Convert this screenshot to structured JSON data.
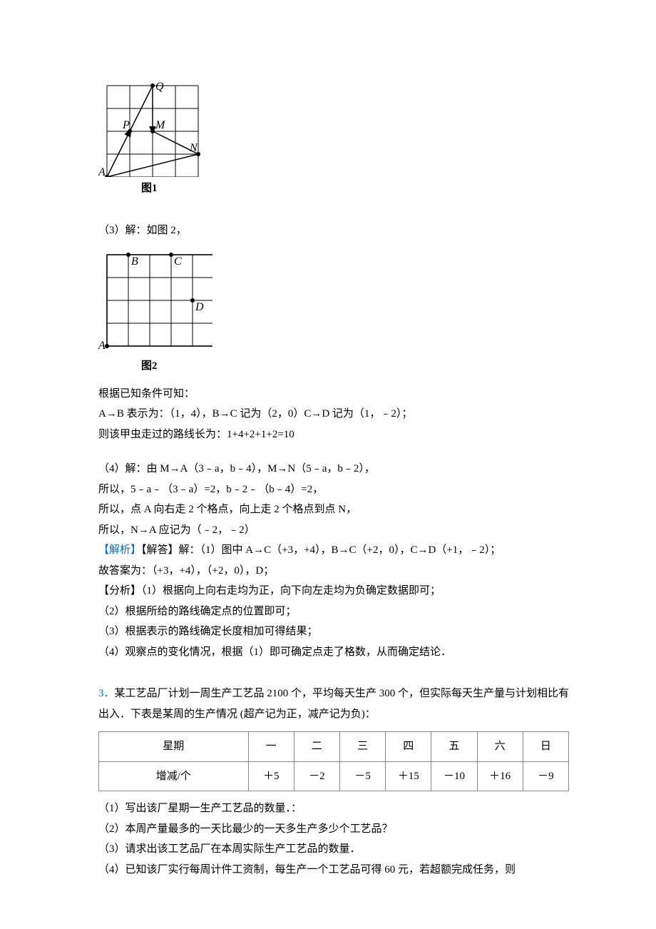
{
  "figure1": {
    "caption": "图1",
    "labels": {
      "A": "A",
      "P": "P",
      "Q": "Q",
      "M": "M",
      "N": "N"
    }
  },
  "section3_intro": "（3）解：如图 2，",
  "figure2": {
    "caption": "图2",
    "labels": {
      "A": "A",
      "B": "B",
      "C": "C",
      "D": "D"
    }
  },
  "p_known": "根据已知条件可知：",
  "p_ab": "A→B 表示为：（1，4），B→C 记为（2，0）C→D 记为（1，﹣2）；",
  "p_length": "则该甲虫走过的路线长为：1+4+2+1+2=10",
  "section4": {
    "l1": "（4）解：由 M→A（3﹣a，b﹣4），M→N（5﹣a，b﹣2），",
    "l2": "所以，5﹣a﹣（3﹣a）=2，b﹣2﹣（b﹣4）=2，",
    "l3": "所以，点 A 向右走 2 个格点，向上走 2 个格点到点 N，",
    "l4": "所以，N→A 应记为（﹣2，﹣2）"
  },
  "analysis": {
    "label": "【解析】",
    "answer": "【解答】解：（1）图中 A→C（+3，+4），B→C（+2，0），C→D（+1，﹣2）；",
    "so": "故答案为：（+3，+4），（+2，0），D；",
    "fenxi_label": "【分析】",
    "fenxi_1": "（1）根据向上向右走均为正，向下向左走均为负确定数据即可；",
    "fenxi_2": "（2）根据所给的路线确定点的位置即可；",
    "fenxi_3": "（3）根据表示的路线确定长度相加可得结果；",
    "fenxi_4": "（4）观察点的变化情况，根据（1）即可确定点走了格数，从而确定结论．"
  },
  "problem3": {
    "num": "3．",
    "text1": "某工艺品厂计划一周生产工艺品 2100 个，平均每天生产 300 个，但实际每天生产量与计划相比有出入．下表是某周的生产情况 (超产记为正，减产记为负)：",
    "table": {
      "row1_label": "星期",
      "row1": [
        "一",
        "二",
        "三",
        "四",
        "五",
        "六",
        "日"
      ],
      "row2_label": "增减/个",
      "row2": [
        "＋5",
        "－2",
        "－5",
        "＋15",
        "－10",
        "＋16",
        "－9"
      ]
    },
    "q1": "（1）写出该厂星期一生产工艺品的数量．：",
    "q2": "（2）本周产量最多的一天比最少的一天多生产多少个工艺品？",
    "q3": "（3）请求出该工艺品厂在本周实际生产工艺品的数量．",
    "q4": "（4）已知该厂实行每周计件工资制，每生产一个工艺品可得 60 元，若超额完成任务，则"
  },
  "chart_data": [
    {
      "type": "table",
      "title": "某周的生产情况（增减/个）",
      "categories": [
        "一",
        "二",
        "三",
        "四",
        "五",
        "六",
        "日"
      ],
      "values": [
        5,
        -2,
        -5,
        15,
        -10,
        16,
        -9
      ],
      "unit": "个"
    }
  ]
}
